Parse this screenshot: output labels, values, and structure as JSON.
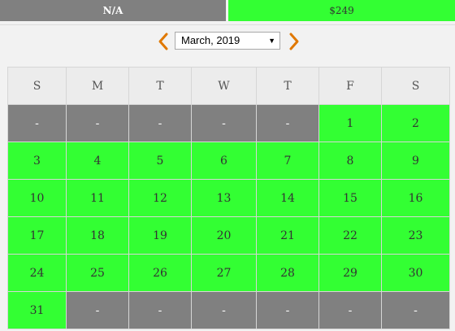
{
  "legend": {
    "na_label": "N/A",
    "price_label": "$249"
  },
  "nav": {
    "month": "March, 2019"
  },
  "weekdays": [
    "S",
    "M",
    "T",
    "W",
    "T",
    "F",
    "S"
  ],
  "weeks": [
    [
      {
        "t": "-",
        "a": false
      },
      {
        "t": "-",
        "a": false
      },
      {
        "t": "-",
        "a": false
      },
      {
        "t": "-",
        "a": false
      },
      {
        "t": "-",
        "a": false
      },
      {
        "t": "1",
        "a": true
      },
      {
        "t": "2",
        "a": true
      }
    ],
    [
      {
        "t": "3",
        "a": true
      },
      {
        "t": "4",
        "a": true
      },
      {
        "t": "5",
        "a": true
      },
      {
        "t": "6",
        "a": true
      },
      {
        "t": "7",
        "a": true
      },
      {
        "t": "8",
        "a": true
      },
      {
        "t": "9",
        "a": true
      }
    ],
    [
      {
        "t": "10",
        "a": true
      },
      {
        "t": "11",
        "a": true
      },
      {
        "t": "12",
        "a": true
      },
      {
        "t": "13",
        "a": true
      },
      {
        "t": "14",
        "a": true
      },
      {
        "t": "15",
        "a": true
      },
      {
        "t": "16",
        "a": true
      }
    ],
    [
      {
        "t": "17",
        "a": true
      },
      {
        "t": "18",
        "a": true
      },
      {
        "t": "19",
        "a": true
      },
      {
        "t": "20",
        "a": true
      },
      {
        "t": "21",
        "a": true
      },
      {
        "t": "22",
        "a": true
      },
      {
        "t": "23",
        "a": true
      }
    ],
    [
      {
        "t": "24",
        "a": true
      },
      {
        "t": "25",
        "a": true
      },
      {
        "t": "26",
        "a": true
      },
      {
        "t": "27",
        "a": true
      },
      {
        "t": "28",
        "a": true
      },
      {
        "t": "29",
        "a": true
      },
      {
        "t": "30",
        "a": true
      }
    ],
    [
      {
        "t": "31",
        "a": true
      },
      {
        "t": "-",
        "a": false
      },
      {
        "t": "-",
        "a": false
      },
      {
        "t": "-",
        "a": false
      },
      {
        "t": "-",
        "a": false
      },
      {
        "t": "-",
        "a": false
      },
      {
        "t": "-",
        "a": false
      }
    ]
  ],
  "colors": {
    "available": "#33ff33",
    "unavailable": "#808080",
    "arrow": "#e07800"
  },
  "icons": {
    "prev": "chevron-left-icon",
    "next": "chevron-right-icon",
    "dropdown": "caret-down-icon"
  }
}
